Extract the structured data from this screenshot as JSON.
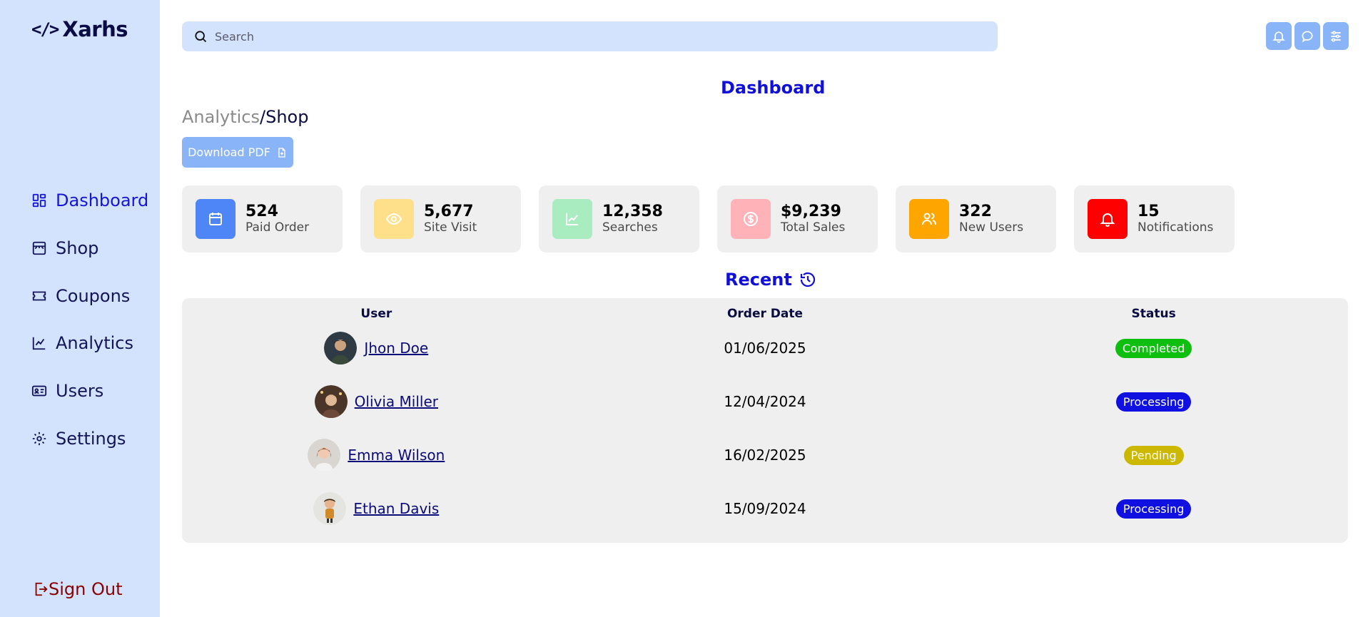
{
  "brand": {
    "code_glyph": "</>",
    "name": "Xarhs"
  },
  "sidebar": {
    "items": [
      {
        "label": "Dashboard",
        "icon": "dashboard-grid-icon",
        "active": true
      },
      {
        "label": "Shop",
        "icon": "shop-icon",
        "active": false
      },
      {
        "label": "Coupons",
        "icon": "ticket-icon",
        "active": false
      },
      {
        "label": "Analytics",
        "icon": "line-chart-icon",
        "active": false
      },
      {
        "label": "Users",
        "icon": "id-card-icon",
        "active": false
      },
      {
        "label": "Settings",
        "icon": "gear-icon",
        "active": false
      }
    ],
    "signout_label": "Sign Out"
  },
  "search": {
    "placeholder": "Search",
    "value": ""
  },
  "top_icons": [
    "bell-icon",
    "chat-icon",
    "sliders-icon"
  ],
  "page_title": "Dashboard",
  "breadcrumb": {
    "parent": "Analytics",
    "separator": "/",
    "current": "Shop"
  },
  "download_label": "Download PDF",
  "stats": [
    {
      "value": "524",
      "label": "Paid Order",
      "icon": "calendar-icon",
      "color": "#4f86f7"
    },
    {
      "value": "5,677",
      "label": "Site Visit",
      "icon": "eye-icon",
      "color": "#ffe08a"
    },
    {
      "value": "12,358",
      "label": "Searches",
      "icon": "trend-icon",
      "color": "#a8ecc0"
    },
    {
      "value": "$9,239",
      "label": "Total Sales",
      "icon": "dollar-coin-icon",
      "color": "#ffb3b8"
    },
    {
      "value": "322",
      "label": "New Users",
      "icon": "users-icon",
      "color": "#ffa500"
    },
    {
      "value": "15",
      "label": "Notifications",
      "icon": "bell-icon",
      "color": "#ff0000"
    }
  ],
  "recent": {
    "title": "Recent",
    "icon": "history-icon",
    "columns": [
      "User",
      "Order Date",
      "Status"
    ],
    "rows": [
      {
        "user": "Jhon Doe",
        "date": "01/06/2025",
        "status": "Completed",
        "status_color": "#0fbf0f"
      },
      {
        "user": "Olivia Miller",
        "date": "12/04/2024",
        "status": "Processing",
        "status_color": "#1010e0"
      },
      {
        "user": "Emma Wilson",
        "date": "16/02/2025",
        "status": "Pending",
        "status_color": "#cdb800"
      },
      {
        "user": "Ethan Davis",
        "date": "15/09/2024",
        "status": "Processing",
        "status_color": "#1010e0"
      }
    ]
  }
}
